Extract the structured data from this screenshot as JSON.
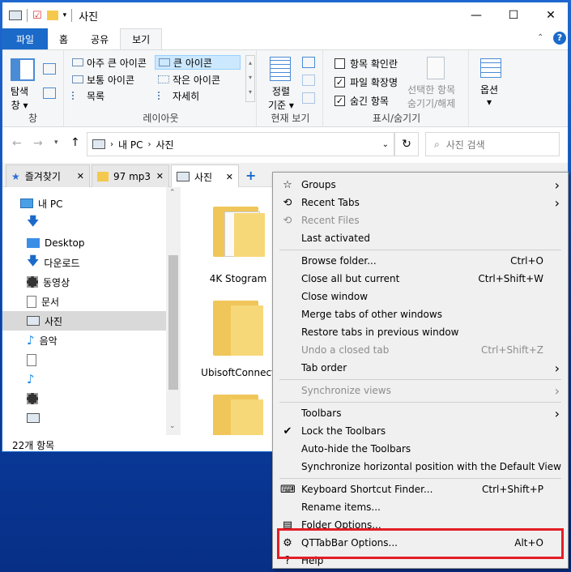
{
  "window": {
    "title": "사진"
  },
  "ribbon_tabs": [
    "파일",
    "홈",
    "공유",
    "보기"
  ],
  "ribbon": {
    "pane_label": "탐색\n창 ▾",
    "pane_group": "창",
    "layouts": [
      "아주 큰 아이콘",
      "큰 아이콘",
      "보통 아이콘",
      "작은 아이콘",
      "목록",
      "자세히"
    ],
    "layout_group": "레이아웃",
    "sort_label": "정렬\n기준 ▾",
    "current_view_group": "현재 보기",
    "checks": [
      {
        "label": "항목 확인란",
        "checked": false
      },
      {
        "label": "파일 확장명",
        "checked": true
      },
      {
        "label": "숨긴 항목",
        "checked": true
      }
    ],
    "hide_selected": "선택한 항목\n숨기기/해제",
    "show_hide_group": "표시/숨기기",
    "options_label": "옵션\n▾"
  },
  "address": {
    "path": [
      "내 PC",
      "사진"
    ],
    "search_placeholder": "사진 검색"
  },
  "qt_tabs": [
    "즐겨찾기",
    "97 mp3",
    "사진"
  ],
  "tree": [
    "내 PC",
    "",
    "Desktop",
    "다운로드",
    "동영상",
    "문서",
    "사진",
    "음악",
    "",
    "",
    "",
    ""
  ],
  "folders": [
    "4K Stogram",
    "UbisoftConnect",
    ""
  ],
  "status": "22개 항목",
  "menu": [
    {
      "label": "Groups",
      "arrow": true,
      "icon": "☆"
    },
    {
      "label": "Recent Tabs",
      "arrow": true,
      "icon": "⟲"
    },
    {
      "label": "Recent Files",
      "disabled": true,
      "icon": "⟲"
    },
    {
      "label": "Last activated"
    },
    {
      "sep": true
    },
    {
      "label": "Browse folder...",
      "shortcut": "Ctrl+O"
    },
    {
      "label": "Close all but current",
      "shortcut": "Ctrl+Shift+W"
    },
    {
      "label": "Close window"
    },
    {
      "label": "Merge tabs of other windows"
    },
    {
      "label": "Restore tabs in previous window"
    },
    {
      "label": "Undo a closed tab",
      "shortcut": "Ctrl+Shift+Z",
      "disabled": true
    },
    {
      "label": "Tab order",
      "arrow": true
    },
    {
      "sep": true
    },
    {
      "label": "Synchronize views",
      "disabled": true,
      "arrow": true
    },
    {
      "sep": true
    },
    {
      "label": "Toolbars",
      "arrow": true
    },
    {
      "label": "Lock the Toolbars",
      "icon": "✔"
    },
    {
      "label": "Auto-hide the Toolbars"
    },
    {
      "label": "Synchronize horizontal position with the Default View"
    },
    {
      "sep": true
    },
    {
      "label": "Keyboard Shortcut Finder...",
      "shortcut": "Ctrl+Shift+P",
      "icon": "⌨"
    },
    {
      "label": "Rename items..."
    },
    {
      "label": "Folder Options...",
      "icon": "▤"
    },
    {
      "label": "QTTabBar Options...",
      "shortcut": "Alt+O",
      "icon": "⚙"
    },
    {
      "label": "Help",
      "icon": "?"
    }
  ]
}
